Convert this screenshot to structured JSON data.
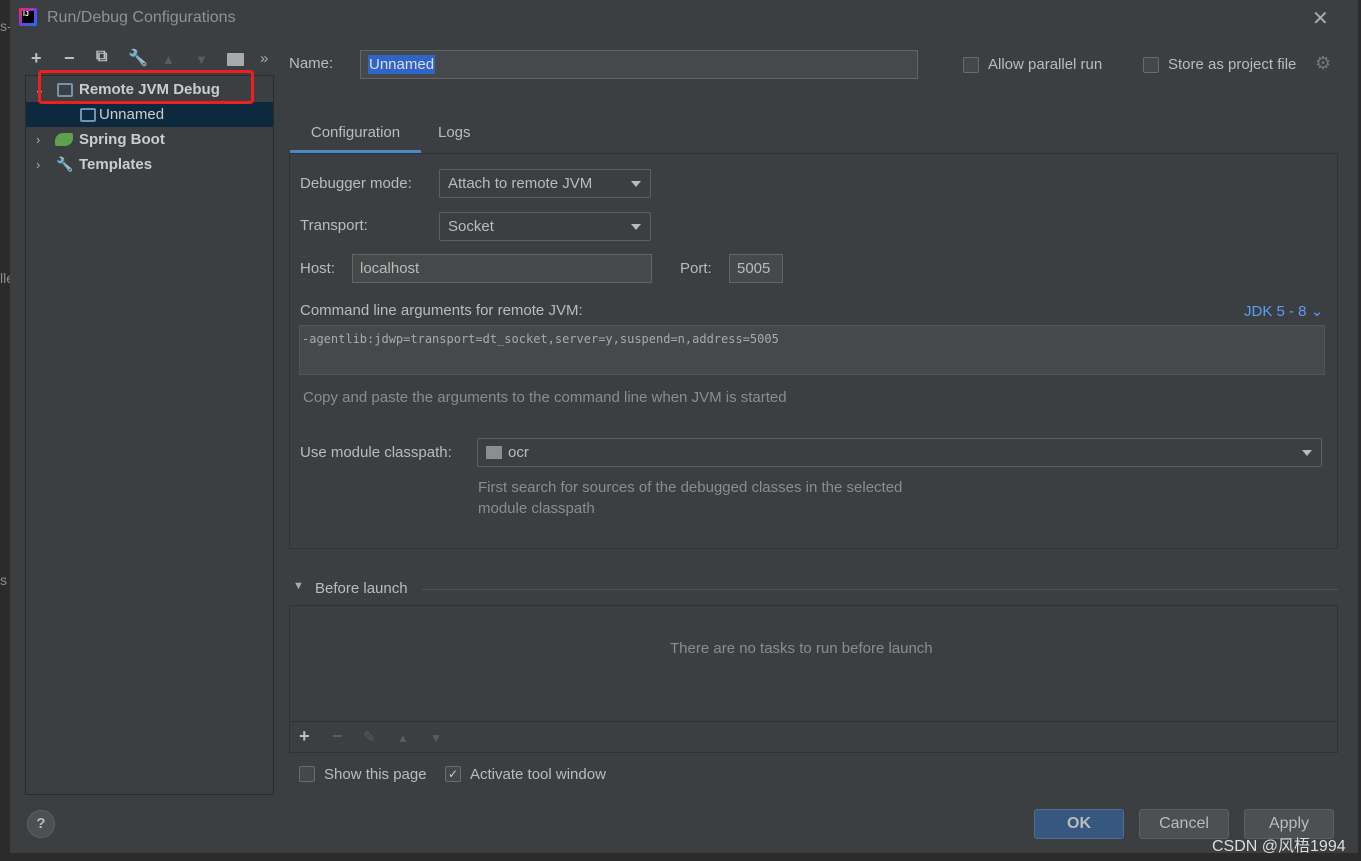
{
  "window": {
    "title": "Run/Debug Configurations"
  },
  "background_fragments": [
    "s-",
    "lle",
    "s"
  ],
  "toolbar": {
    "icons": [
      "add-icon",
      "remove-icon",
      "copy-icon",
      "wrench-icon",
      "move-up-icon",
      "move-down-icon",
      "new-folder-icon",
      "more-icon"
    ],
    "more": "»"
  },
  "tree": {
    "items": [
      {
        "label": "Remote JVM Debug",
        "expanded": true,
        "bold": true
      },
      {
        "label": "Unnamed",
        "selected": true
      },
      {
        "label": "Spring Boot",
        "bold": true
      },
      {
        "label": "Templates",
        "bold": true
      }
    ]
  },
  "name": {
    "label": "Name:",
    "value": "Unnamed"
  },
  "allow_parallel": {
    "label": "Allow parallel run",
    "checked": false
  },
  "store_project": {
    "label": "Store as project file",
    "checked": false
  },
  "tabs": [
    {
      "label": "Configuration",
      "active": true
    },
    {
      "label": "Logs"
    }
  ],
  "config": {
    "debugger_mode_label": "Debugger mode:",
    "debugger_mode": "Attach to remote JVM",
    "transport_label": "Transport:",
    "transport": "Socket",
    "host_label": "Host:",
    "host": "localhost",
    "port_label": "Port:",
    "port": "5005",
    "cmd_label": "Command line arguments for remote JVM:",
    "jdk": "JDK 5 - 8",
    "cmd": "-agentlib:jdwp=transport=dt_socket,server=y,suspend=n,address=5005",
    "cmd_hint": "Copy and paste the arguments to the command line when JVM is started",
    "classpath_label": "Use module classpath:",
    "classpath": "ocr",
    "classpath_hint1": "First search for sources of the debugged classes in the selected",
    "classpath_hint2": "module classpath"
  },
  "before_launch": {
    "label": "Before launch",
    "empty": "There are no tasks to run before launch"
  },
  "show_page": {
    "label": "Show this page",
    "checked": false
  },
  "activate_tool": {
    "label": "Activate tool window",
    "checked": true
  },
  "buttons": {
    "help": "?",
    "ok": "OK",
    "cancel": "Cancel",
    "apply": "Apply"
  },
  "watermark": "CSDN @风梧1994",
  "colors": {
    "accent": "#4a88c7",
    "highlight": "#f01e1e",
    "ok": "#365880"
  }
}
